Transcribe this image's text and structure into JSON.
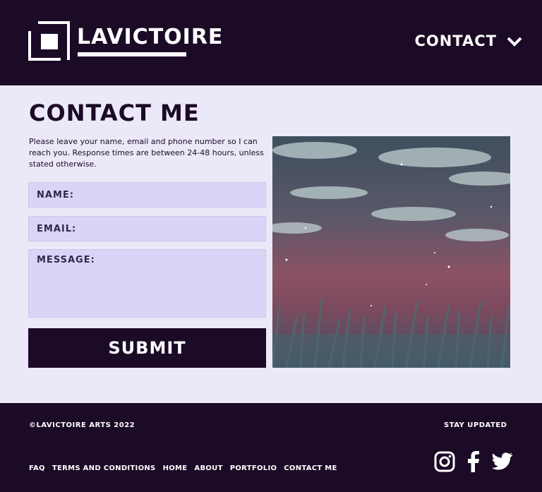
{
  "header": {
    "brand": "LAVICTOIRE",
    "nav_label": "CONTACT"
  },
  "main": {
    "title": "CONTACT ME",
    "intro": "Please leave your name, email and phone number so I can reach you. Response times are between 24-48 hours, unless stated otherwise.",
    "form": {
      "name_placeholder": "NAME:",
      "email_placeholder": "EMAIL:",
      "message_placeholder": "MESSAGE:",
      "submit_label": "SUBMIT"
    }
  },
  "footer": {
    "copyright": "©LAVICTOIRE ARTS 2022",
    "stay_updated": "STAY UPDATED",
    "links": [
      "FAQ",
      "TERMS AND CONDITIONS",
      "HOME",
      "ABOUT",
      "PORTFOLIO",
      "CONTACT ME"
    ]
  },
  "colors": {
    "dark": "#1b0b27",
    "background": "#ebe8f8",
    "field": "#dad5f7"
  }
}
